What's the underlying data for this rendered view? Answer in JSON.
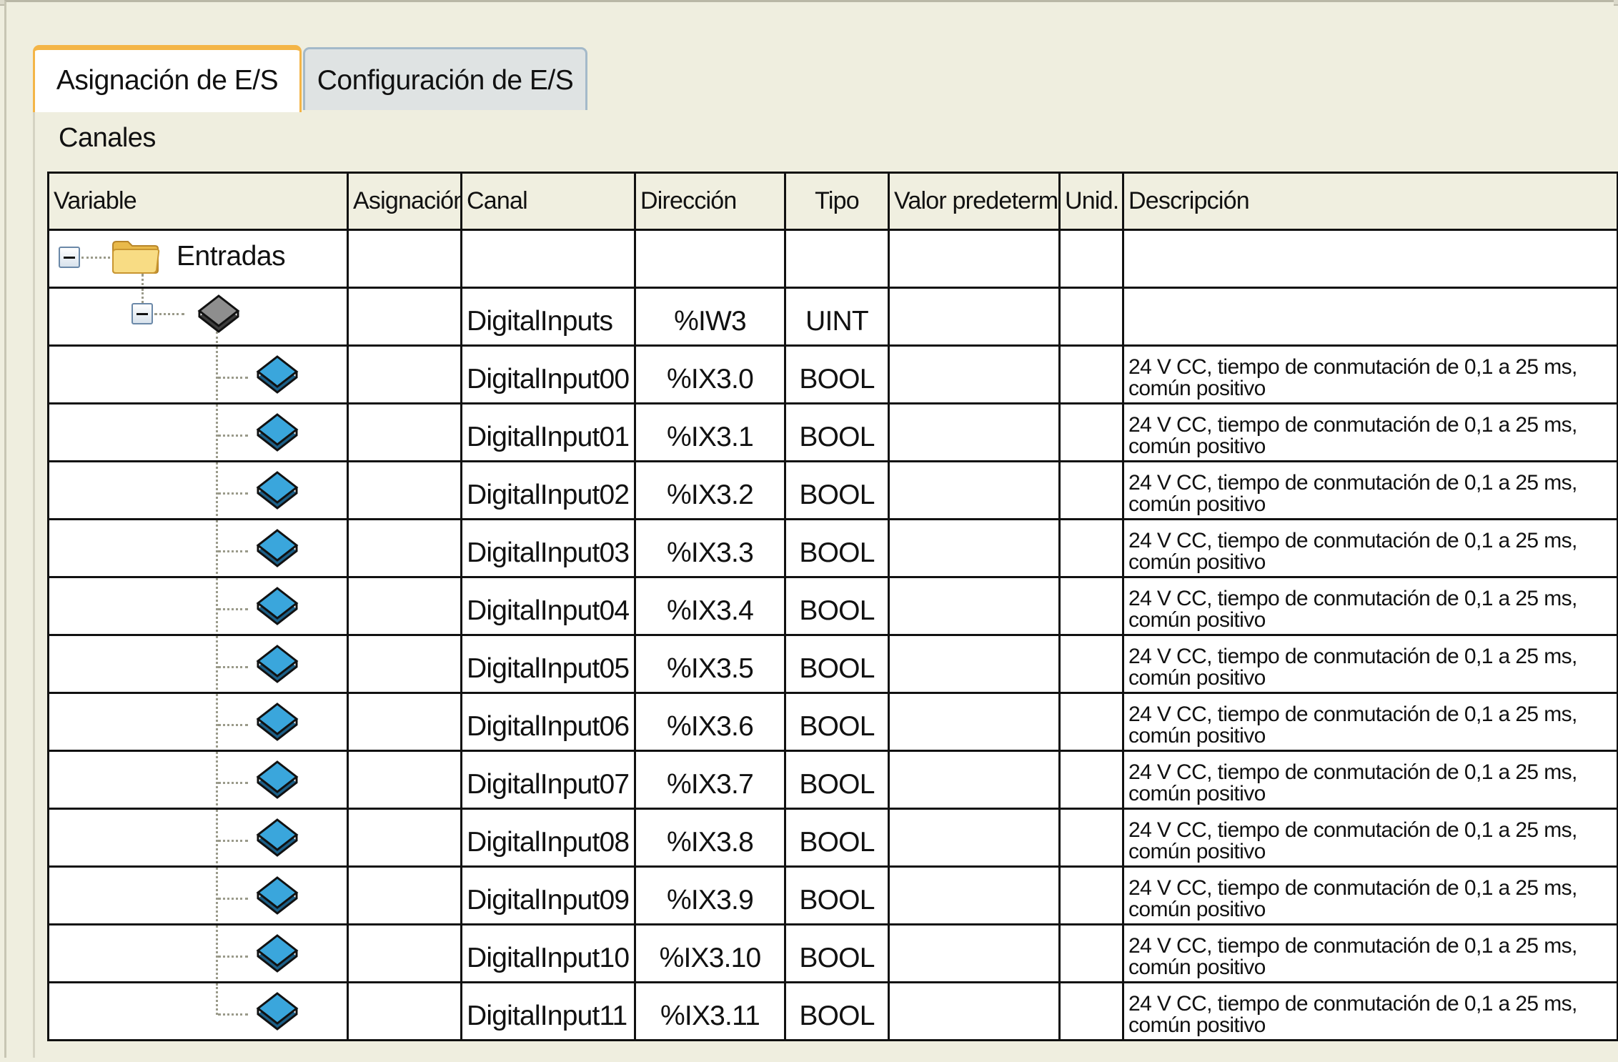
{
  "tabs": [
    {
      "label": "Asignación de E/S",
      "active": true
    },
    {
      "label": "Configuración de E/S",
      "active": false
    }
  ],
  "panel": {
    "title": "Canales"
  },
  "table": {
    "headers": {
      "variable": "Variable",
      "asignacion": "Asignación",
      "canal": "Canal",
      "direccion": "Dirección",
      "tipo": "Tipo",
      "valor": "Valor predeterm.",
      "unid": "Unid.",
      "descripcion": "Descripción"
    },
    "group": {
      "label": "Entradas",
      "icon": "folder-icon",
      "expanded": true
    },
    "parent": {
      "icon": "gray-channel-icon",
      "expanded": true,
      "canal": "DigitalInputs",
      "direccion": "%IW3",
      "tipo": "UINT"
    },
    "rows": [
      {
        "canal": "DigitalInput00",
        "direccion": "%IX3.0",
        "tipo": "BOOL",
        "desc1": "24 V CC, tiempo de conmutación de 0,1 a 25 ms,",
        "desc2": "común positivo"
      },
      {
        "canal": "DigitalInput01",
        "direccion": "%IX3.1",
        "tipo": "BOOL",
        "desc1": "24 V CC, tiempo de conmutación de 0,1 a 25 ms,",
        "desc2": "común positivo"
      },
      {
        "canal": "DigitalInput02",
        "direccion": "%IX3.2",
        "tipo": "BOOL",
        "desc1": "24 V CC, tiempo de conmutación de 0,1 a 25 ms,",
        "desc2": "común positivo"
      },
      {
        "canal": "DigitalInput03",
        "direccion": "%IX3.3",
        "tipo": "BOOL",
        "desc1": "24 V CC, tiempo de conmutación de 0,1 a 25 ms,",
        "desc2": "común positivo"
      },
      {
        "canal": "DigitalInput04",
        "direccion": "%IX3.4",
        "tipo": "BOOL",
        "desc1": "24 V CC, tiempo de conmutación de 0,1 a 25 ms,",
        "desc2": "común positivo"
      },
      {
        "canal": "DigitalInput05",
        "direccion": "%IX3.5",
        "tipo": "BOOL",
        "desc1": "24 V CC, tiempo de conmutación de 0,1 a 25 ms,",
        "desc2": "común positivo"
      },
      {
        "canal": "DigitalInput06",
        "direccion": "%IX3.6",
        "tipo": "BOOL",
        "desc1": "24 V CC, tiempo de conmutación de 0,1 a 25 ms,",
        "desc2": "común positivo"
      },
      {
        "canal": "DigitalInput07",
        "direccion": "%IX3.7",
        "tipo": "BOOL",
        "desc1": "24 V CC, tiempo de conmutación de 0,1 a 25 ms,",
        "desc2": "común positivo"
      },
      {
        "canal": "DigitalInput08",
        "direccion": "%IX3.8",
        "tipo": "BOOL",
        "desc1": "24 V CC, tiempo de conmutación de 0,1 a 25 ms,",
        "desc2": "común positivo"
      },
      {
        "canal": "DigitalInput09",
        "direccion": "%IX3.9",
        "tipo": "BOOL",
        "desc1": "24 V CC, tiempo de conmutación de 0,1 a 25 ms,",
        "desc2": "común positivo"
      },
      {
        "canal": "DigitalInput10",
        "direccion": "%IX3.10",
        "tipo": "BOOL",
        "desc1": "24 V CC, tiempo de conmutación de 0,1 a 25 ms,",
        "desc2": "común positivo"
      },
      {
        "canal": "DigitalInput11",
        "direccion": "%IX3.11",
        "tipo": "BOOL",
        "desc1": "24 V CC, tiempo de conmutación de 0,1 a 25 ms,",
        "desc2": "común positivo"
      }
    ]
  },
  "colors": {
    "active_tab_accent": "#f4b547",
    "tab_border": "#a4b9c9",
    "channel_icon_blue": "#3aa6dc",
    "channel_icon_gray": "#8e8e8e",
    "folder_yellow": "#f6d67a"
  }
}
